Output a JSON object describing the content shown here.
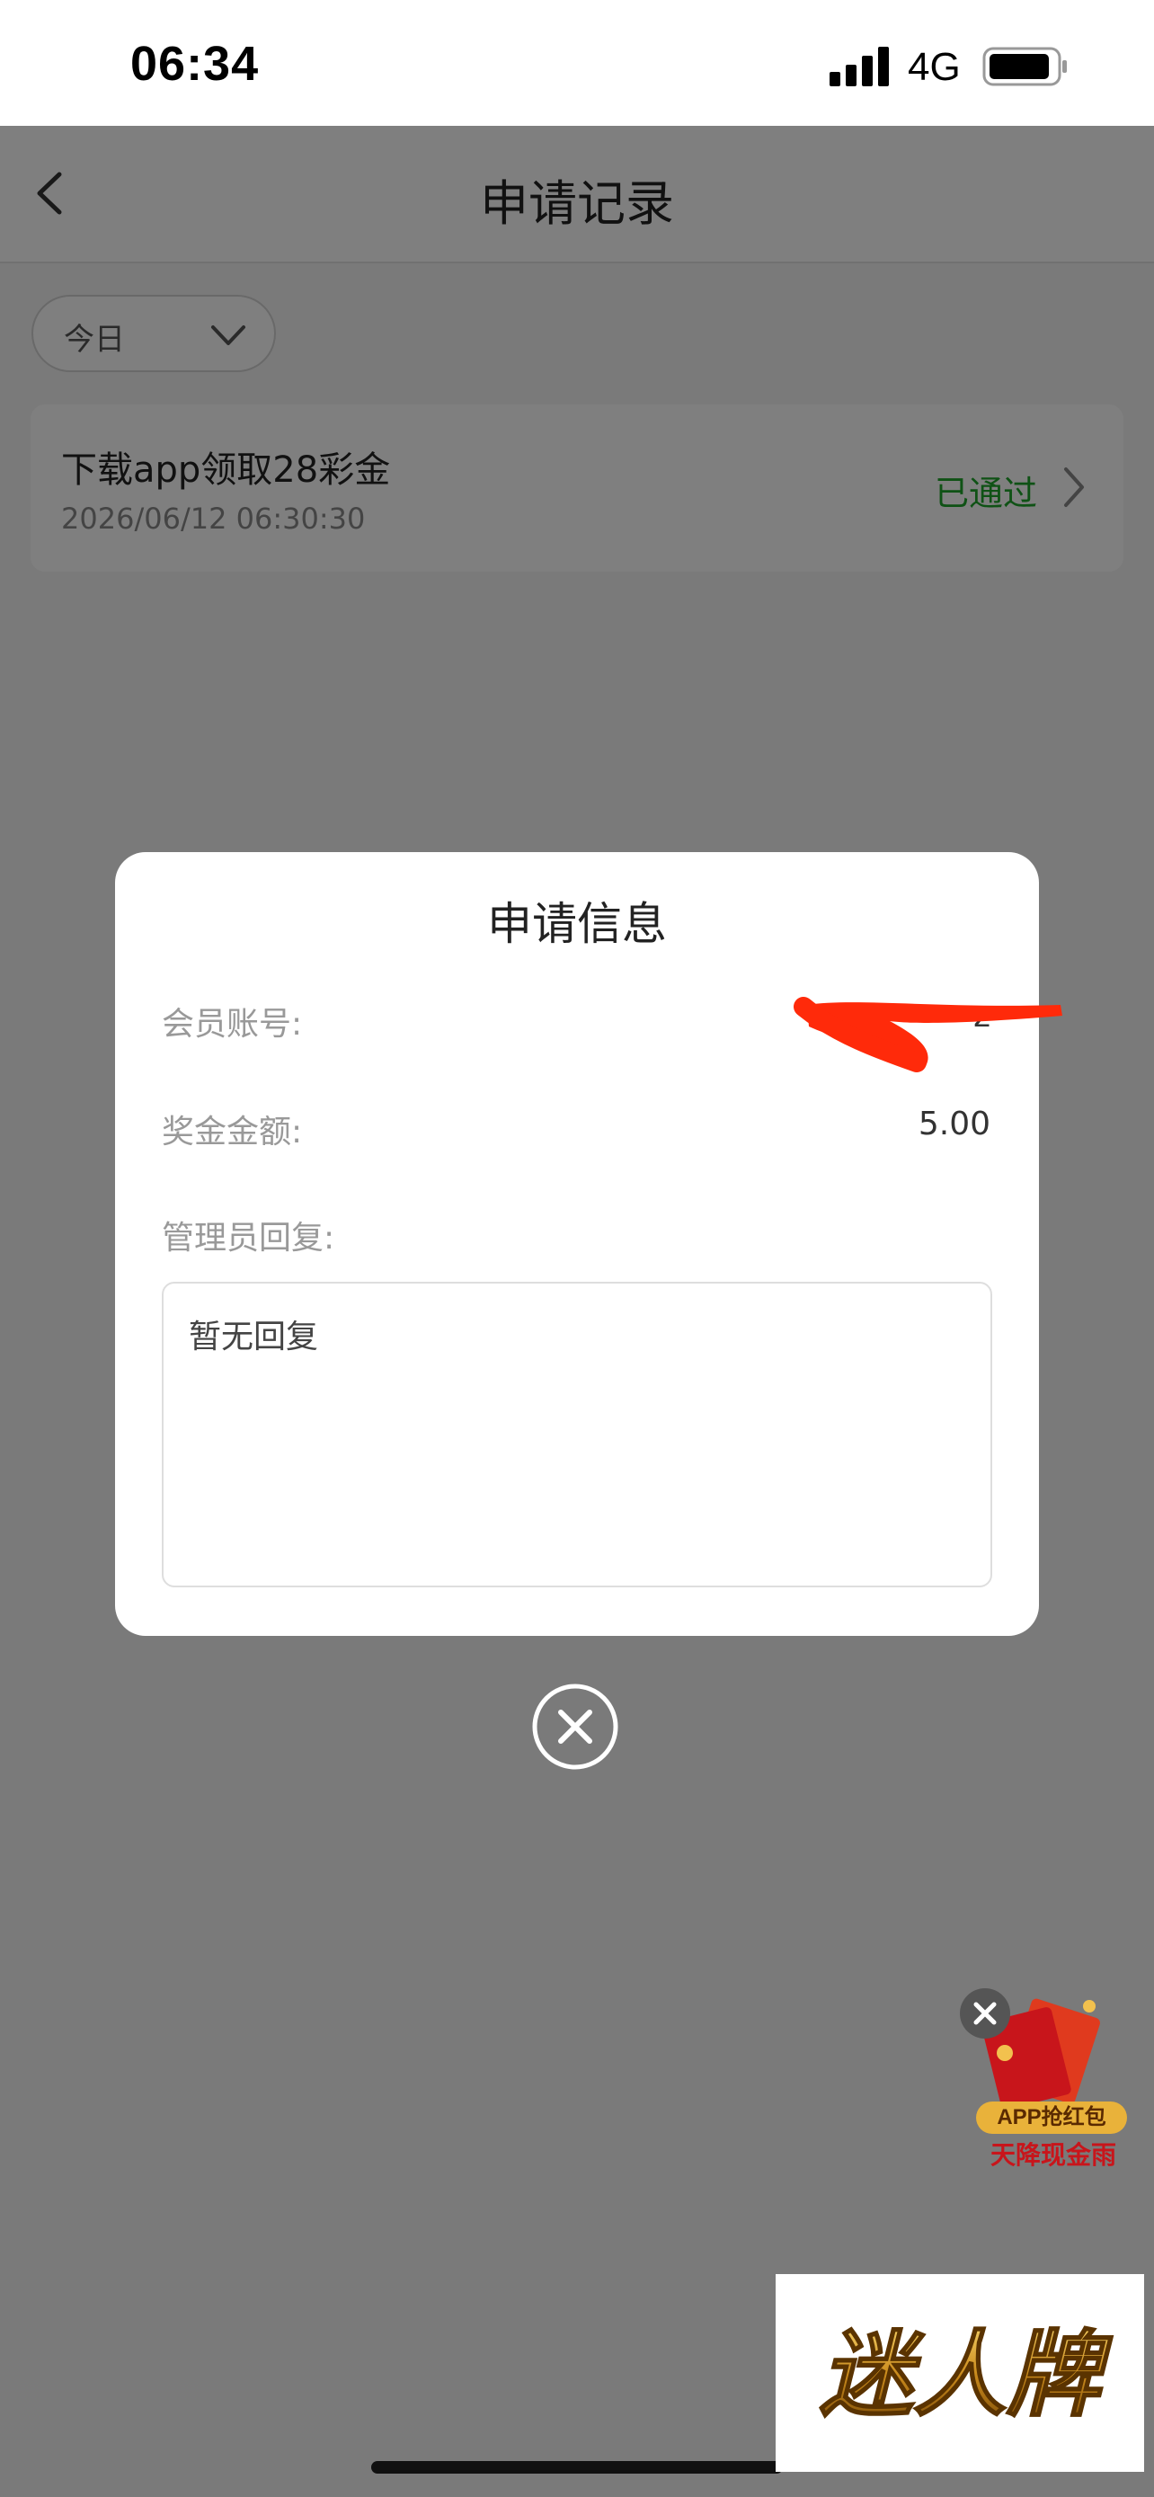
{
  "status_bar": {
    "time": "06:34",
    "network": "4G"
  },
  "header": {
    "title": "申请记录",
    "back_icon": "chevron-left-icon"
  },
  "filter": {
    "selected": "今日",
    "icon": "chevron-down-icon"
  },
  "records": [
    {
      "title": "下载app领取28彩金",
      "time": "2026/06/12 06:30:30",
      "status": "已通过",
      "status_color": "#1fa42a"
    }
  ],
  "modal": {
    "title": "申请信息",
    "member_label": "会员账号:",
    "member_value": "z",
    "bonus_label": "奖金金额:",
    "bonus_value": "5.00",
    "reply_label": "管理员回复:",
    "reply_text": "暂无回复",
    "close_icon": "close-circle-icon"
  },
  "float_ad": {
    "badge": "APP抢红包",
    "subtitle": "天降现金雨",
    "close_icon": "close-icon"
  },
  "watermark": {
    "text": "迷人牌"
  },
  "colors": {
    "accent_green": "#1fa42a",
    "mask": "rgba(0,0,0,0.5)",
    "annotation_red": "#ff2a0a"
  }
}
